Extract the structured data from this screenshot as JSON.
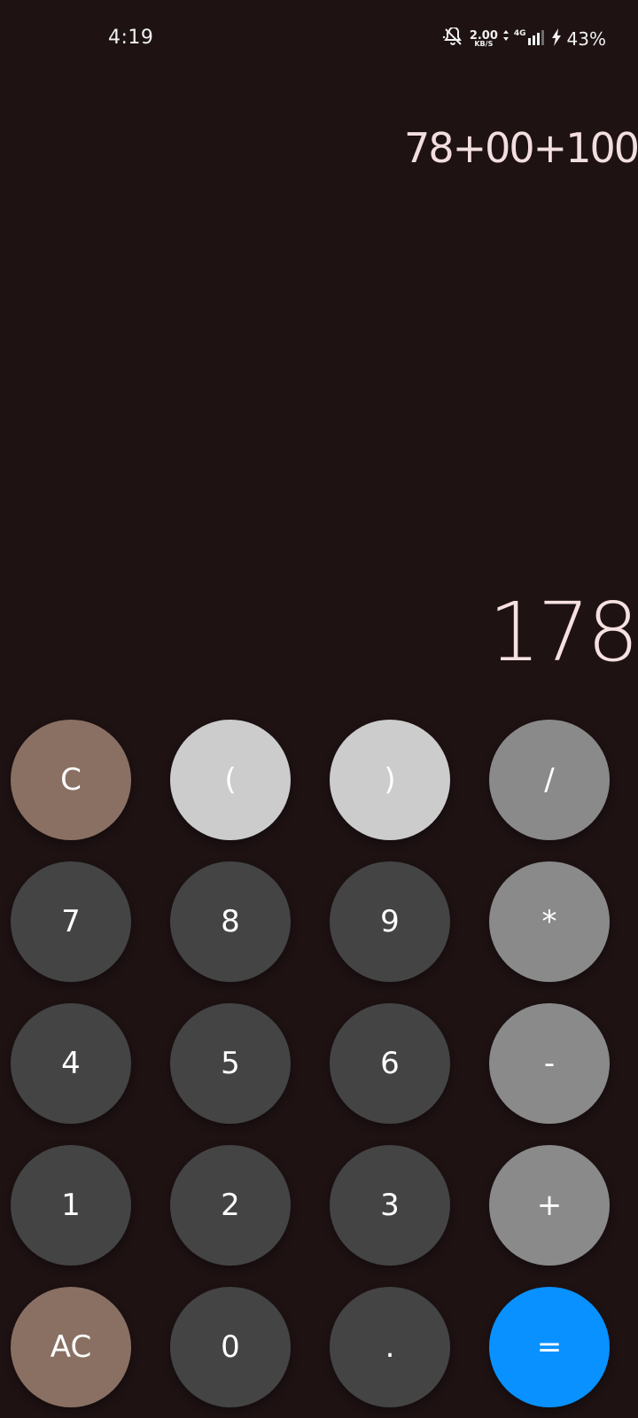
{
  "status_bar": {
    "time": "4:19",
    "net_speed_value": "2.00",
    "net_speed_unit": "KB/S",
    "network_type": "4G",
    "battery": "43%",
    "icons": [
      "mute-icon",
      "data-arrows-icon",
      "signal-icon",
      "charging-icon"
    ]
  },
  "display": {
    "expression": "78+00+100",
    "result": "178"
  },
  "keypad": {
    "rows": [
      [
        "C",
        "(",
        ")",
        "/"
      ],
      [
        "7",
        "8",
        "9",
        "*"
      ],
      [
        "4",
        "5",
        "6",
        "-"
      ],
      [
        "1",
        "2",
        "3",
        "+"
      ],
      [
        "AC",
        "0",
        ".",
        "="
      ]
    ]
  },
  "colors": {
    "background": "#1e1213",
    "clear_key": "#8a7063",
    "paren_key": "#cccccc",
    "operator_key": "#8a8a8a",
    "digit_key": "#444444",
    "equals_key": "#0891ff",
    "display_text": "#f3dede"
  }
}
